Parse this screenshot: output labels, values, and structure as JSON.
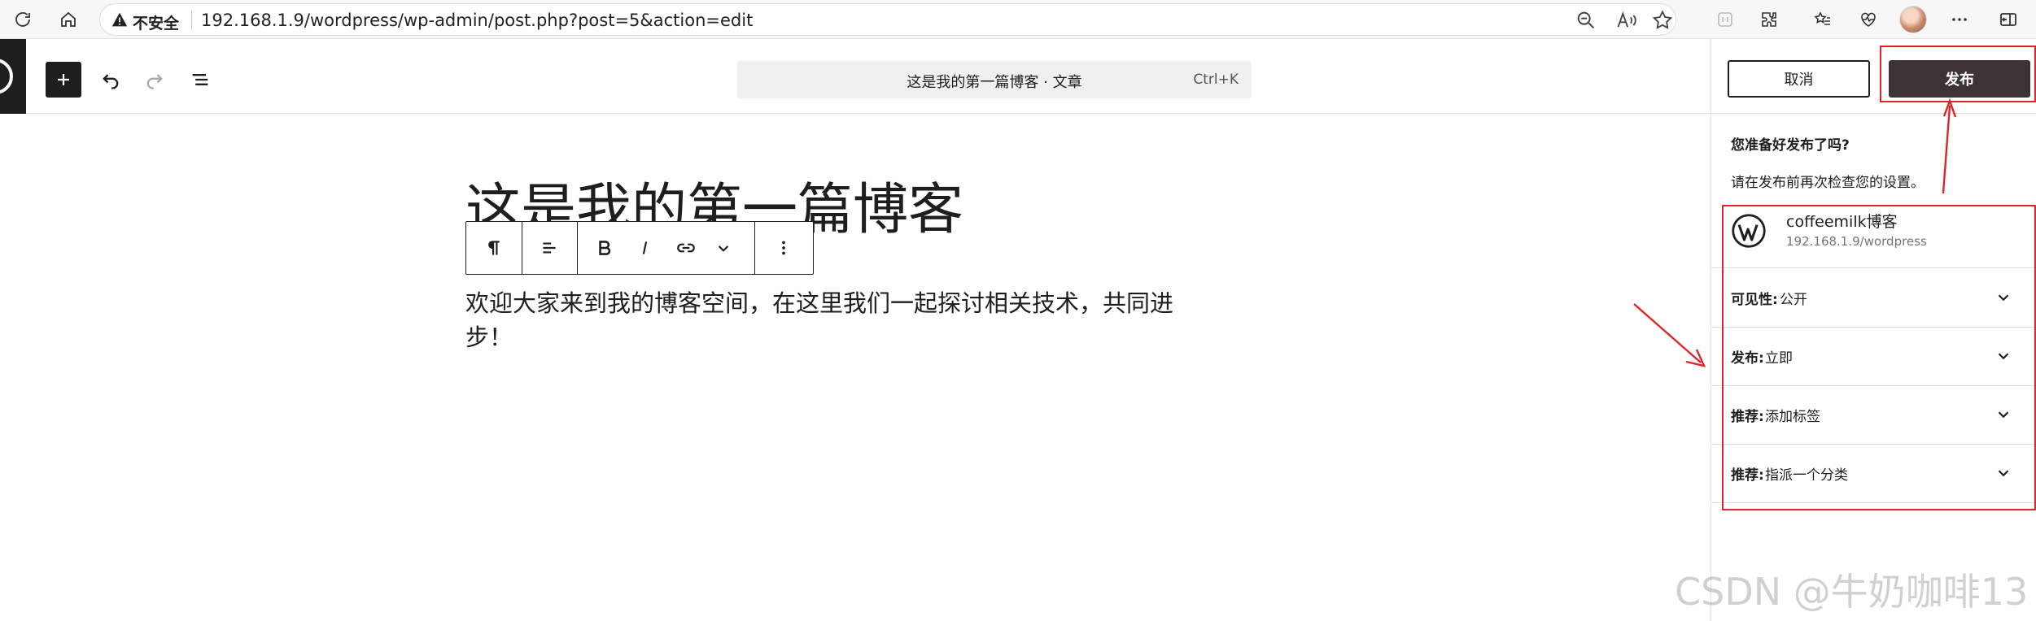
{
  "browser": {
    "insecure_label": "不安全",
    "url": "192.168.1.9/wordpress/wp-admin/post.php?post=5&action=edit",
    "icons": [
      "refresh-icon",
      "home-icon",
      "warning-icon",
      "zoom-out-icon",
      "read-aloud-icon",
      "favorite-star-icon",
      "split-screen-icon",
      "extensions-icon",
      "favorites-list-icon",
      "health-icon",
      "avatar",
      "more-icon",
      "sidebar-icon"
    ]
  },
  "editor": {
    "command_title": "这是我的第一篇博客 · 文章",
    "command_shortcut": "Ctrl+K",
    "post_title": "这是我的第一篇博客",
    "post_body": "欢迎大家来到我的博客空间，在这里我们一起探讨相关技术，共同进步！",
    "block_toolbar_icons": [
      "paragraph-icon",
      "align-icon",
      "bold-icon",
      "italic-icon",
      "link-icon",
      "more-formats-chevron-icon",
      "options-kebab-icon"
    ]
  },
  "publish_panel": {
    "cancel_label": "取消",
    "publish_label": "发布",
    "ready_question": "您准备好发布了吗?",
    "ready_hint": "请在发布前再次检查您的设置。",
    "site_name": "coffeemilk博客",
    "site_url": "192.168.1.9/wordpress",
    "options": [
      {
        "label": "可见性:",
        "value": "公开"
      },
      {
        "label": "发布:",
        "value": "立即"
      },
      {
        "label": "推荐:",
        "value": "添加标签"
      },
      {
        "label": "推荐:",
        "value": "指派一个分类"
      }
    ]
  },
  "watermark": "CSDN @牛奶咖啡13",
  "colors": {
    "publish_button": "#3c3434",
    "annotation_red": "#e0242a",
    "wp_dark": "#1e1e1e"
  }
}
